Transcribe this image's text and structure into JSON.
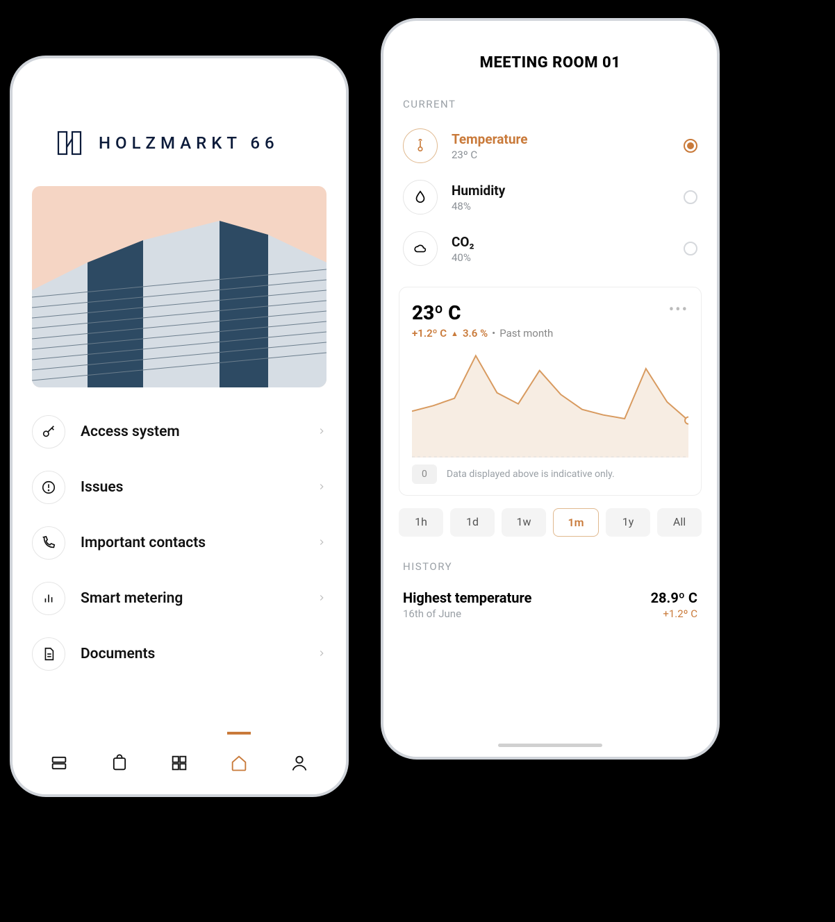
{
  "left": {
    "logo_text": "HOLZMARKT 66",
    "menu": [
      {
        "label": "Access system",
        "icon": "key-icon"
      },
      {
        "label": "Issues",
        "icon": "alert-circle-icon"
      },
      {
        "label": "Important contacts",
        "icon": "phone-icon"
      },
      {
        "label": "Smart metering",
        "icon": "bar-chart-icon"
      },
      {
        "label": "Documents",
        "icon": "document-icon"
      }
    ],
    "tabbar_active_index": 3
  },
  "right": {
    "title": "MEETING ROOM 01",
    "section_current": "CURRENT",
    "metrics": [
      {
        "name": "Temperature",
        "value": "23º C",
        "icon": "thermometer-icon",
        "selected": true
      },
      {
        "name": "Humidity",
        "value": "48%",
        "icon": "droplet-icon",
        "selected": false
      },
      {
        "name": "CO₂",
        "value": "40%",
        "icon": "cloud-icon",
        "selected": false
      }
    ],
    "card": {
      "big_value": "23º C",
      "delta_value": "+1.2º C",
      "delta_pct": "3.6 %",
      "period": "Past month",
      "baseline_zero": "0",
      "disclaimer": "Data displayed above is indicative only."
    },
    "ranges": [
      "1h",
      "1d",
      "1w",
      "1m",
      "1y",
      "All"
    ],
    "range_selected": "1m",
    "section_history": "HISTORY",
    "history": {
      "label": "Highest temperature",
      "date": "16th of June",
      "value": "28.9º C",
      "delta": "+1.2º C"
    }
  },
  "chart_data": {
    "type": "line",
    "title": "Temperature — Past month",
    "ylabel": "ºC",
    "xlabel": "",
    "ylim": [
      20,
      26
    ],
    "x": [
      0,
      1,
      2,
      3,
      4,
      5,
      6,
      7,
      8,
      9,
      10,
      11,
      12,
      13
    ],
    "values": [
      22.5,
      22.8,
      23.2,
      25.5,
      23.5,
      22.9,
      24.7,
      23.4,
      22.6,
      22.3,
      22.1,
      24.8,
      23.0,
      22.0
    ]
  }
}
